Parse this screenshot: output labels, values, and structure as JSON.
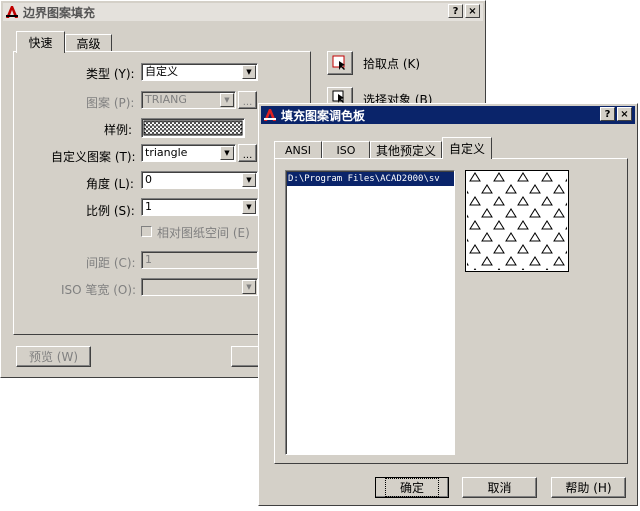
{
  "boundary_dialog": {
    "title": "边界图案填充",
    "help_glyph": "?",
    "close_glyph": "×",
    "tabs": [
      {
        "label": "快速"
      },
      {
        "label": "高级"
      }
    ],
    "type_label": "类型 (Y):",
    "type_value": "自定义",
    "pattern_label": "图案 (P):",
    "pattern_value": "TRIANG",
    "swatch_label": "样例:",
    "custom_pattern_label": "自定义图案 (T):",
    "custom_pattern_value": "triangle",
    "angle_label": "角度 (L):",
    "angle_value": "0",
    "scale_label": "比例 (S):",
    "scale_value": "1",
    "paper_space_label": "相对图纸空间 (E)",
    "spacing_label": "间距 (C):",
    "spacing_value": "1",
    "iso_label": "ISO 笔宽 (O):",
    "iso_value": "",
    "pick_points_label": "拾取点 (K)",
    "select_objects_label": "选择对象 (B)",
    "preview_label": "预览 (W)",
    "ellipsis": "..."
  },
  "palette_dialog": {
    "title": "填充图案调色板",
    "help_glyph": "?",
    "close_glyph": "×",
    "tabs": [
      {
        "label": "ANSI"
      },
      {
        "label": "ISO"
      },
      {
        "label": "其他预定义"
      },
      {
        "label": "自定义"
      }
    ],
    "file_list": [
      {
        "path": "D:\\Program Files\\ACAD2000\\sv"
      }
    ],
    "preview_pattern": "triangle",
    "ok_label": "确定",
    "cancel_label": "取消",
    "help_label": "帮助 (H)"
  },
  "colors": {
    "active_title": "#0a246a",
    "dialog_face": "#d4d0c8",
    "selection": "#0a246a"
  }
}
